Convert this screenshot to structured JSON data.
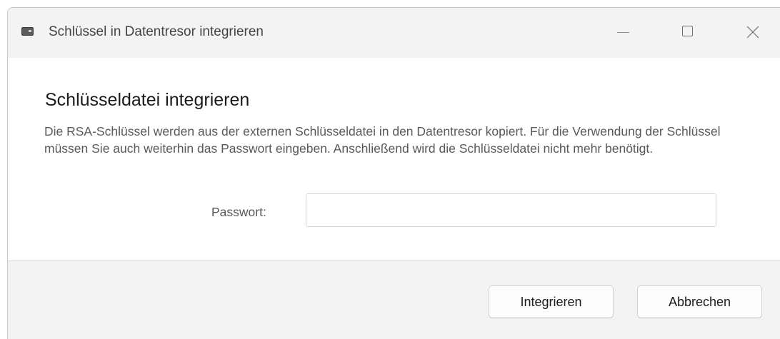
{
  "window": {
    "title": "Schlüssel in Datentresor integrieren",
    "icon": "wallet-icon",
    "controls": [
      "minimize-icon",
      "maximize-icon",
      "close-icon"
    ]
  },
  "dialog": {
    "heading": "Schlüsseldatei integrieren",
    "description": "Die RSA-Schlüssel werden aus der externen Schlüsseldatei in den Datentresor kopiert. Für die Verwendung der Schlüssel müssen Sie auch weiterhin das Passwort eingeben. Anschließend wird die Schlüsseldatei nicht mehr benötigt.",
    "password_label": "Passwort:",
    "password_value": ""
  },
  "buttons": {
    "integrate_label": "Integrieren",
    "cancel_label": "Abbrechen"
  },
  "colors": {
    "titlebar_bg": "#f3f3f3",
    "footer_bg": "#f3f3f3",
    "body_bg": "#ffffff",
    "text_primary": "#1b1b1b",
    "text_secondary": "#595959"
  }
}
